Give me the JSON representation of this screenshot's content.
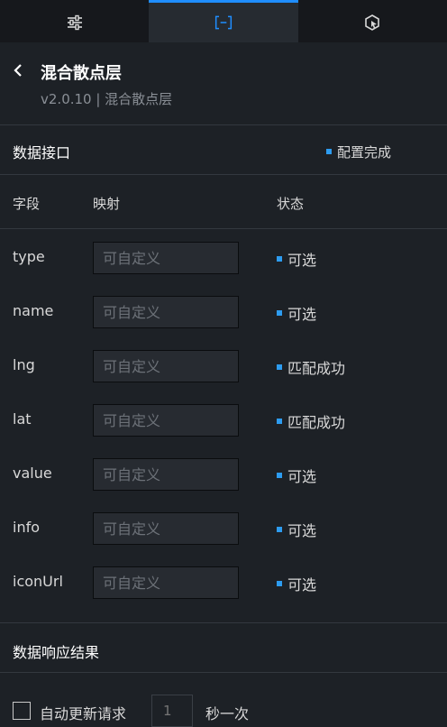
{
  "tabs": [
    {
      "name": "style",
      "icon": "sliders-icon",
      "active": false
    },
    {
      "name": "data",
      "icon": "data-bracket-icon",
      "active": true
    },
    {
      "name": "interaction",
      "icon": "interaction-icon",
      "active": false
    }
  ],
  "header": {
    "title": "混合散点层",
    "subtitle": "v2.0.10 | 混合散点层"
  },
  "data_interface": {
    "title": "数据接口",
    "status": "配置完成"
  },
  "columns": {
    "field": "字段",
    "mapping": "映射",
    "status": "状态"
  },
  "fields": [
    {
      "name": "type",
      "placeholder": "可自定义",
      "value": "",
      "status": "可选"
    },
    {
      "name": "name",
      "placeholder": "可自定义",
      "value": "",
      "status": "可选"
    },
    {
      "name": "lng",
      "placeholder": "可自定义",
      "value": "",
      "status": "匹配成功"
    },
    {
      "name": "lat",
      "placeholder": "可自定义",
      "value": "",
      "status": "匹配成功"
    },
    {
      "name": "value",
      "placeholder": "可自定义",
      "value": "",
      "status": "可选"
    },
    {
      "name": "info",
      "placeholder": "可自定义",
      "value": "",
      "status": "可选"
    },
    {
      "name": "iconUrl",
      "placeholder": "可自定义",
      "value": "",
      "status": "可选"
    }
  ],
  "response": {
    "title": "数据响应结果"
  },
  "auto_update": {
    "label": "自动更新请求",
    "checked": false,
    "interval_placeholder": "1",
    "unit": "秒一次"
  },
  "colors": {
    "accent": "#1f8eff",
    "status_dot": "#2d9cf0",
    "background": "#1d2126"
  }
}
